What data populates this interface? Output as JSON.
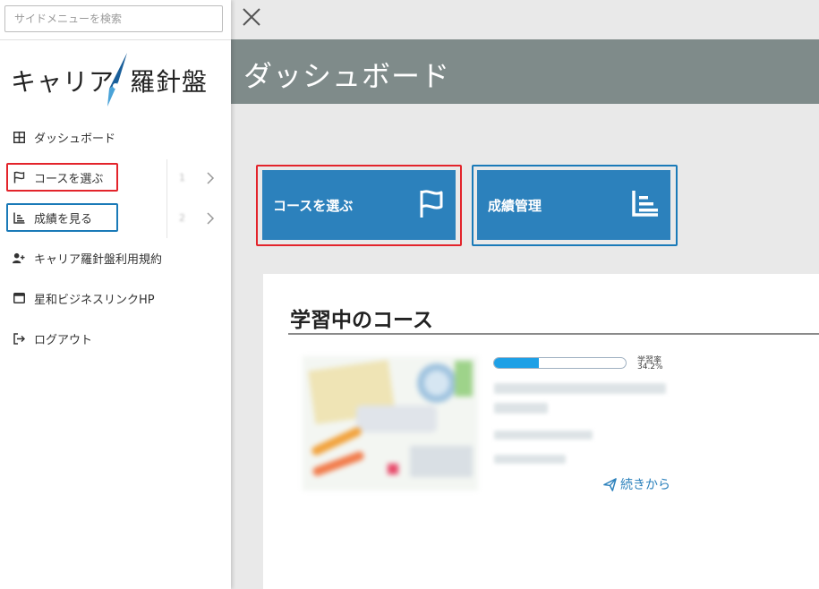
{
  "search": {
    "placeholder": "サイドメニューを検索"
  },
  "logo": {
    "text_left": "キャリア",
    "text_right": "羅針盤"
  },
  "sidebar": {
    "items": [
      {
        "label": "ダッシュボード",
        "icon": "grid-icon"
      },
      {
        "label": "コースを選ぶ",
        "icon": "flag-icon",
        "count": "1"
      },
      {
        "label": "成績を見る",
        "icon": "bar-list-icon",
        "count": "2"
      },
      {
        "label": "キャリア羅針盤利用規約",
        "icon": "user-plus-icon"
      },
      {
        "label": "星和ビジネスリンクHP",
        "icon": "window-icon"
      },
      {
        "label": "ログアウト",
        "icon": "logout-icon"
      }
    ]
  },
  "header": {
    "title": "ダッシュボード"
  },
  "buttons": {
    "course": {
      "label": "コースを選ぶ",
      "icon": "flag-icon"
    },
    "grades": {
      "label": "成績管理",
      "icon": "bar-list-icon"
    }
  },
  "course_card": {
    "title": "学習中のコース",
    "progress_label": "学習率",
    "progress_value": "34.2%",
    "progress_fraction": 0.342,
    "continue_label": "続きから"
  },
  "colors": {
    "header_bg": "#7f8b8a",
    "button_bg": "#2c81bc",
    "highlight_red": "#e3242b",
    "highlight_blue": "#1a7ab8",
    "progress_fill": "#1ea0e6"
  }
}
